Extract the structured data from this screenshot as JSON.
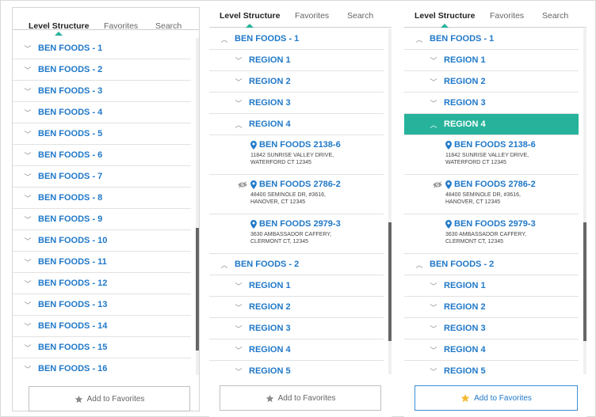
{
  "tabs": [
    "Level Structure",
    "Favorites",
    "Search"
  ],
  "panel1": {
    "items": [
      "BEN FOODS - 1",
      "BEN FOODS - 2",
      "BEN FOODS - 3",
      "BEN FOODS - 4",
      "BEN FOODS - 5",
      "BEN FOODS - 6",
      "BEN FOODS - 7",
      "BEN FOODS - 8",
      "BEN FOODS - 9",
      "BEN FOODS - 10",
      "BEN FOODS - 11",
      "BEN FOODS - 12",
      "BEN FOODS - 13",
      "BEN FOODS - 14",
      "BEN FOODS - 15",
      "BEN FOODS - 16"
    ],
    "favorites_label": "Add to Favorites"
  },
  "tree": {
    "company1": "BEN FOODS - 1",
    "regions1": [
      "REGION 1",
      "REGION 2",
      "REGION 3"
    ],
    "region4": "REGION 4",
    "locations": [
      {
        "name": "BEN FOODS 2138-6",
        "addr1": "11842 SUNRISE VALLEY DRIVE,",
        "addr2": "WATERFORD CT 12345",
        "hidden": false
      },
      {
        "name": "BEN FOODS 2786-2",
        "addr1": "48400 SEMINOLE DR, #3616,",
        "addr2": "HANOVER, CT 12345",
        "hidden": true
      },
      {
        "name": "BEN FOODS 2979-3",
        "addr1": "3630 AMBASSADOR CAFFERY,",
        "addr2": "CLERMONT CT, 12345",
        "hidden": false
      }
    ],
    "company2": "BEN FOODS - 2",
    "regions2": [
      "REGION 1",
      "REGION 2",
      "REGION 3",
      "REGION 4",
      "REGION 5"
    ]
  },
  "panel2": {
    "favorites_label": "Add to Favorites"
  },
  "panel3": {
    "favorites_label": "Add to Favorites"
  },
  "colors": {
    "accent": "#27b39b",
    "link": "#1f78c8",
    "star_active": "#f5b82e",
    "star_inactive": "#8a8a8a"
  },
  "icons": [
    "chevron-down-icon",
    "chevron-up-icon",
    "map-pin-icon",
    "eye-slash-icon",
    "star-icon"
  ]
}
